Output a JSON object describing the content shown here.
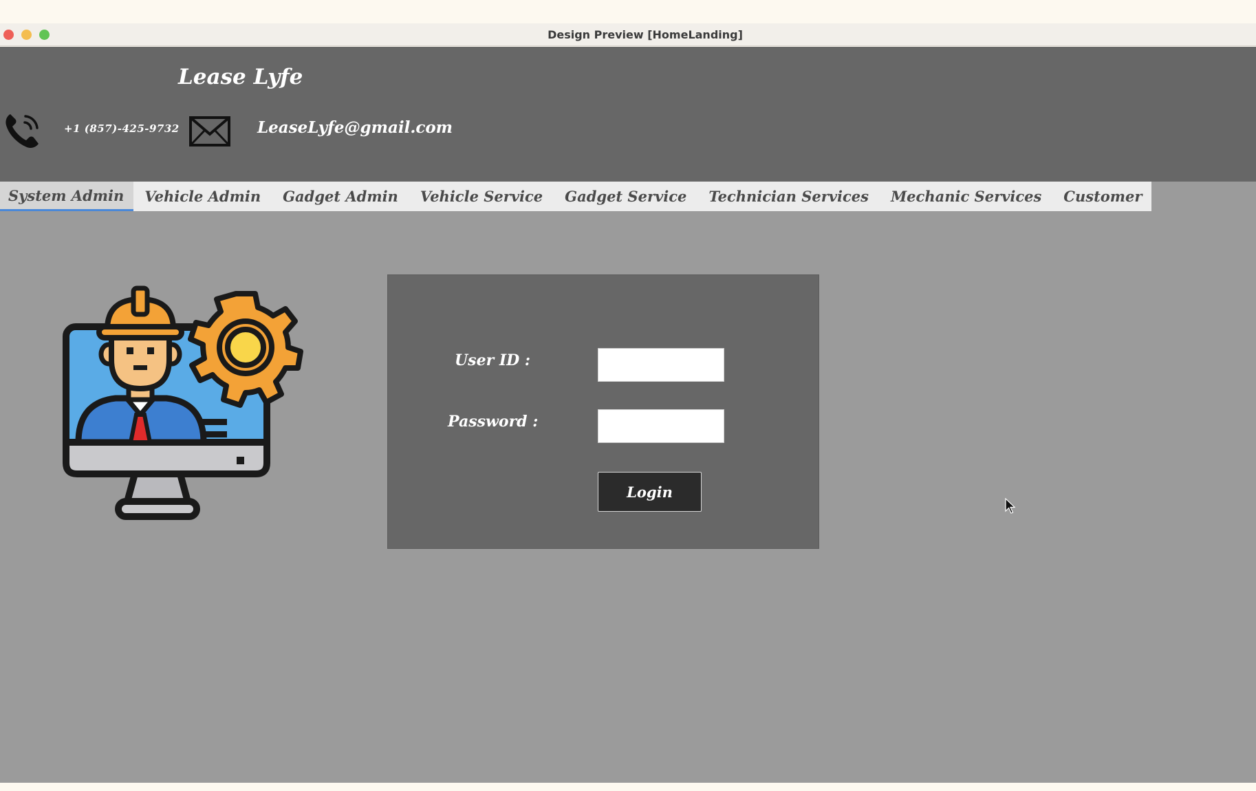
{
  "window": {
    "title": "Design Preview [HomeLanding]"
  },
  "header": {
    "brand": "Lease Lyfe",
    "phone": "+1 (857)-425-9732",
    "email": "LeaseLyfe@gmail.com",
    "phone_icon": "phone-icon",
    "mail_icon": "envelope-icon"
  },
  "tabs": [
    {
      "label": "System Admin",
      "active": true
    },
    {
      "label": "Vehicle Admin"
    },
    {
      "label": "Gadget Admin"
    },
    {
      "label": "Vehicle Service"
    },
    {
      "label": "Gadget Service"
    },
    {
      "label": "Technician Services"
    },
    {
      "label": "Mechanic Services"
    },
    {
      "label": "Customer"
    }
  ],
  "illustration": {
    "icon": "admin-engineer-computer-gear-icon"
  },
  "login": {
    "user_label": "User ID :",
    "user_value": "",
    "password_label": "Password :",
    "password_value": "",
    "button_label": "Login"
  },
  "colors": {
    "header_bg": "#676767",
    "body_bg": "#9b9b9b",
    "panel_bg": "#676767",
    "button_bg": "#2b2b2b",
    "active_tab_underline": "#4a88d8"
  }
}
